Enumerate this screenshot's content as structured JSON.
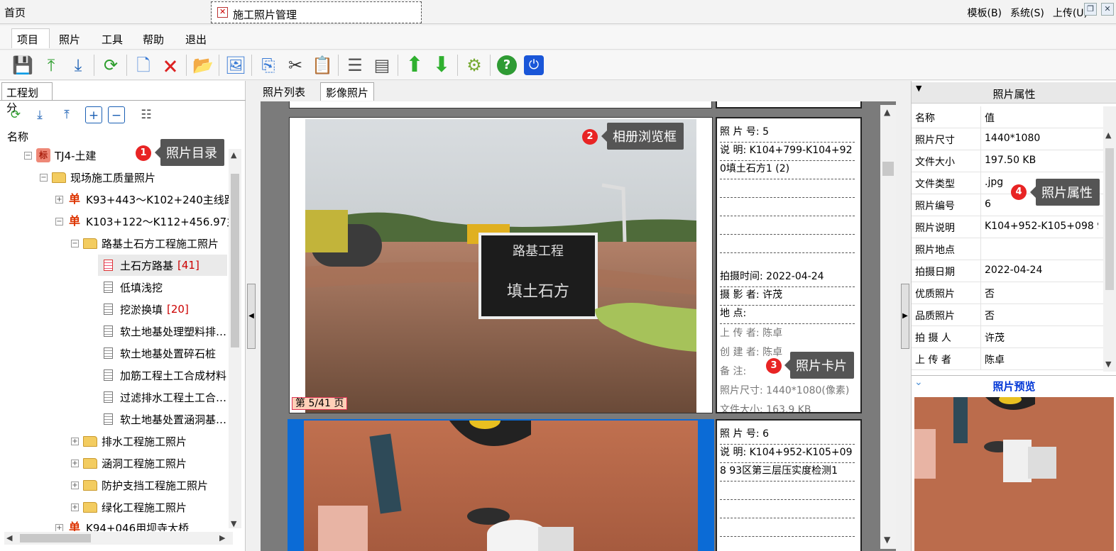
{
  "titlebar": {
    "home_tab": "首页",
    "doc_tab": "施工照片管理",
    "right_menu": [
      "模板(B)",
      "系统(S)",
      "上传(U)"
    ],
    "restore_icon": "restore-icon",
    "close_icon": "close-icon"
  },
  "menu": [
    "项目",
    "照片",
    "工具",
    "帮助",
    "退出"
  ],
  "toolbar": {
    "icons": [
      "save-icon",
      "upload-icon",
      "download-icon",
      "refresh-icon",
      "new-icon",
      "delete-icon",
      "open-folder-icon",
      "image-icon",
      "copy-icon",
      "cut-icon",
      "paste-icon",
      "list-icon",
      "details-icon",
      "move-up-icon",
      "move-down-icon",
      "settings-icon",
      "help-icon",
      "power-icon"
    ]
  },
  "left_panel": {
    "tab": "工程划分",
    "column_header": "名称",
    "tree": [
      {
        "label": "TJ4-土建",
        "icon": "标",
        "level": 0
      },
      {
        "label": "现场施工质量照片",
        "level": 1
      },
      {
        "label": "K93+443～K102+240主线路基",
        "icon": "单",
        "level": 2
      },
      {
        "label": "K103+122～K112+456.97主线…",
        "icon": "单",
        "level": 2
      },
      {
        "label": "路基土石方工程施工照片",
        "level": 3
      },
      {
        "label": "土石方路基",
        "count": "[41]",
        "level": 4
      },
      {
        "label": "低填浅挖",
        "level": 4
      },
      {
        "label": "挖淤换填",
        "count": "[20]",
        "level": 4
      },
      {
        "label": "软土地基处理塑料排…",
        "level": 4
      },
      {
        "label": "软土地基处置碎石桩",
        "level": 4
      },
      {
        "label": "加筋工程土工合成材料",
        "level": 4
      },
      {
        "label": "过滤排水工程土工合…",
        "level": 4
      },
      {
        "label": "软土地基处置涵洞基…",
        "level": 4
      },
      {
        "label": "排水工程施工照片",
        "level": 3
      },
      {
        "label": "涵洞工程施工照片",
        "level": 3
      },
      {
        "label": "防护支挡工程施工照片",
        "level": 3
      },
      {
        "label": "绿化工程施工照片",
        "level": 3
      },
      {
        "label": "K94+046用坝寺大桥",
        "icon": "单",
        "level": 2
      }
    ]
  },
  "center": {
    "tabs": [
      "照片列表",
      "影像照片"
    ],
    "page_badge": "第 5/41 页",
    "card1": {
      "photo_no_label": "照 片 号:",
      "photo_no": "5",
      "desc_label": "说    明:",
      "desc_line1": "K104+799-K104+92",
      "desc_line2": "0填土石方1 (2)",
      "time_label": "拍摄时间:",
      "time": "2022-04-24",
      "photographer_label": "摄 影 者:",
      "photographer": "许茂",
      "place_label": "地    点:",
      "uploader_label": "上 传 者:",
      "uploader": "陈卓",
      "creator_label": "创 建 者:",
      "creator": "陈卓",
      "note_label": "备    注:",
      "size_label": "照片尺寸:",
      "size": "1440*1080(像素)",
      "file_label": "文件大小:",
      "file": "163.9 KB",
      "sign_text": "路基工程",
      "sign_text2": "填土石方"
    },
    "card2": {
      "photo_no_label": "照 片 号:",
      "photo_no": "6",
      "desc_label": "说    明:",
      "desc_line1": "K104+952-K105+09",
      "desc_line2": "8 93区第三层压实度检测1"
    }
  },
  "right_panel": {
    "header": "照片属性",
    "col_name": "名称",
    "col_value": "值",
    "props": [
      {
        "k": "照片尺寸",
        "v": "1440*1080"
      },
      {
        "k": "文件大小",
        "v": "197.50 KB"
      },
      {
        "k": "文件类型",
        "v": ".jpg"
      },
      {
        "k": "照片编号",
        "v": "6"
      },
      {
        "k": "照片说明",
        "v": "K104+952-K105+098 9…"
      },
      {
        "k": "照片地点",
        "v": ""
      },
      {
        "k": "拍摄日期",
        "v": "2022-04-24"
      },
      {
        "k": "优质照片",
        "v": "否"
      },
      {
        "k": "品质照片",
        "v": "否"
      },
      {
        "k": "拍 摄 人",
        "v": "许茂"
      },
      {
        "k": "上 传 者",
        "v": "陈卓"
      }
    ],
    "preview_title": "照片预览"
  },
  "callouts": [
    {
      "num": "1",
      "text": "照片目录"
    },
    {
      "num": "2",
      "text": "相册浏览框"
    },
    {
      "num": "3",
      "text": "照片卡片"
    },
    {
      "num": "4",
      "text": "照片属性"
    }
  ],
  "colors": {
    "accent_blue": "#0b6bd6",
    "count_red": "#cc0000",
    "callout_red": "#e82424"
  }
}
